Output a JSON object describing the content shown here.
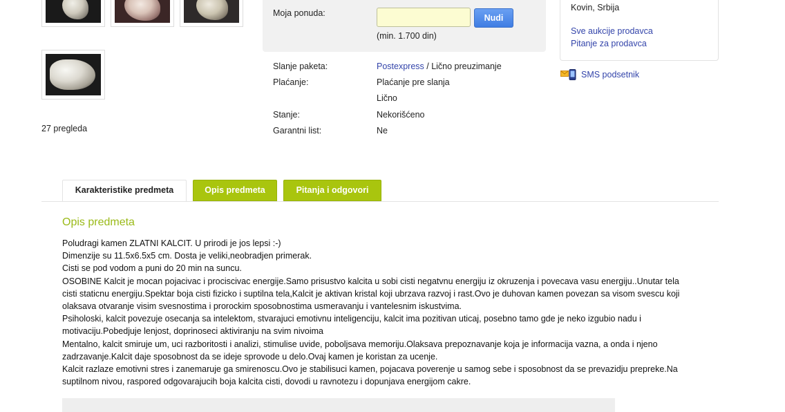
{
  "gallery": {
    "views": "27 pregleda"
  },
  "bid": {
    "label": "Moja ponuda:",
    "input_value": "",
    "button": "Nudi",
    "minimum": "(min. 1.700 din)",
    "input_bg": "#fcfcd2",
    "button_color": "#3f7de3"
  },
  "details": {
    "shipping_label": "Slanje paketa:",
    "shipping_link": "Postexpress",
    "shipping_sep": " / ",
    "shipping_rest": "Lično preuzimanje",
    "payment_label": "Plaćanje:",
    "payment_value_1": "Plaćanje pre slanja",
    "payment_value_2": "Lično",
    "condition_label": "Stanje:",
    "condition_value": "Nekorišćeno",
    "warranty_label": "Garantni list:",
    "warranty_value": "Ne"
  },
  "seller": {
    "location": "Kovin, Srbija",
    "all_auctions": "Sve aukcije prodavca",
    "ask_seller": "Pitanje za prodavca",
    "sms": "SMS podsetnik"
  },
  "tabs": {
    "features": "Karakteristike predmeta",
    "description": "Opis predmeta",
    "questions": "Pitanja i odgovori",
    "accent_color": "#a9c50e"
  },
  "description": {
    "title": "Opis predmeta",
    "title_color": "#9aba18",
    "lines": [
      "Poludragi kamen ZLATNI KALCIT. U prirodi je jos lepsi :-)",
      "Dimenzije su 11.5x6.5x5 cm. Dosta je veliki,neobradjen primerak.",
      "Cisti se pod vodom a puni do 20 min na suncu.",
      "OSOBINE Kalcit je mocan pojacivac i prociscivac energije.Samo prisustvo kalcita u sobi cisti negatvnu energiju iz okruzenja i povecava vasu energiju..Unutar tela cisti staticnu energiju.Spektar boja cisti fizicko i suptilna tela,Kalcit je aktivan kristal koji ubrzava razvoj i rast.Ovo je duhovan kamen povezan sa visom svescu koji olaksava otvaranje visim svesnostima i prorockim sposobnostima usmeravanju i vantelesnim iskustvima.",
      "Psiholoski, kalcit povezuje osecanja sa intelektom, stvarajuci emotivnu inteligenciju, kalcit ima pozitivan uticaj, posebno tamo gde je neko izgubio nadu i motivaciju.Pobedjuje lenjost, doprinoseci aktiviranju na svim nivoima",
      "Mentalno, kalcit smiruje um, uci razboritosti i analizi, stimulise uvide, poboljsava memoriju.Olaksava prepoznavanje koja je informacija vazna, a onda i njeno zadrzavanje.Kalcit daje sposobnost da se ideje sprovode u delo.Ovaj kamen je koristan za ucenje.",
      "Kalcit razlaze emotivni stres i zanemaruje ga smirenoscu.Ovo je stabilisuci kamen, pojacava poverenje u samog sebe i sposobnost da se prevazidju prepreke.Na suptilnom nivou, raspored odgovarajucih boja kalcita cisti, dovodi u ravnotezu i dopunjava energijom cakre."
    ]
  }
}
